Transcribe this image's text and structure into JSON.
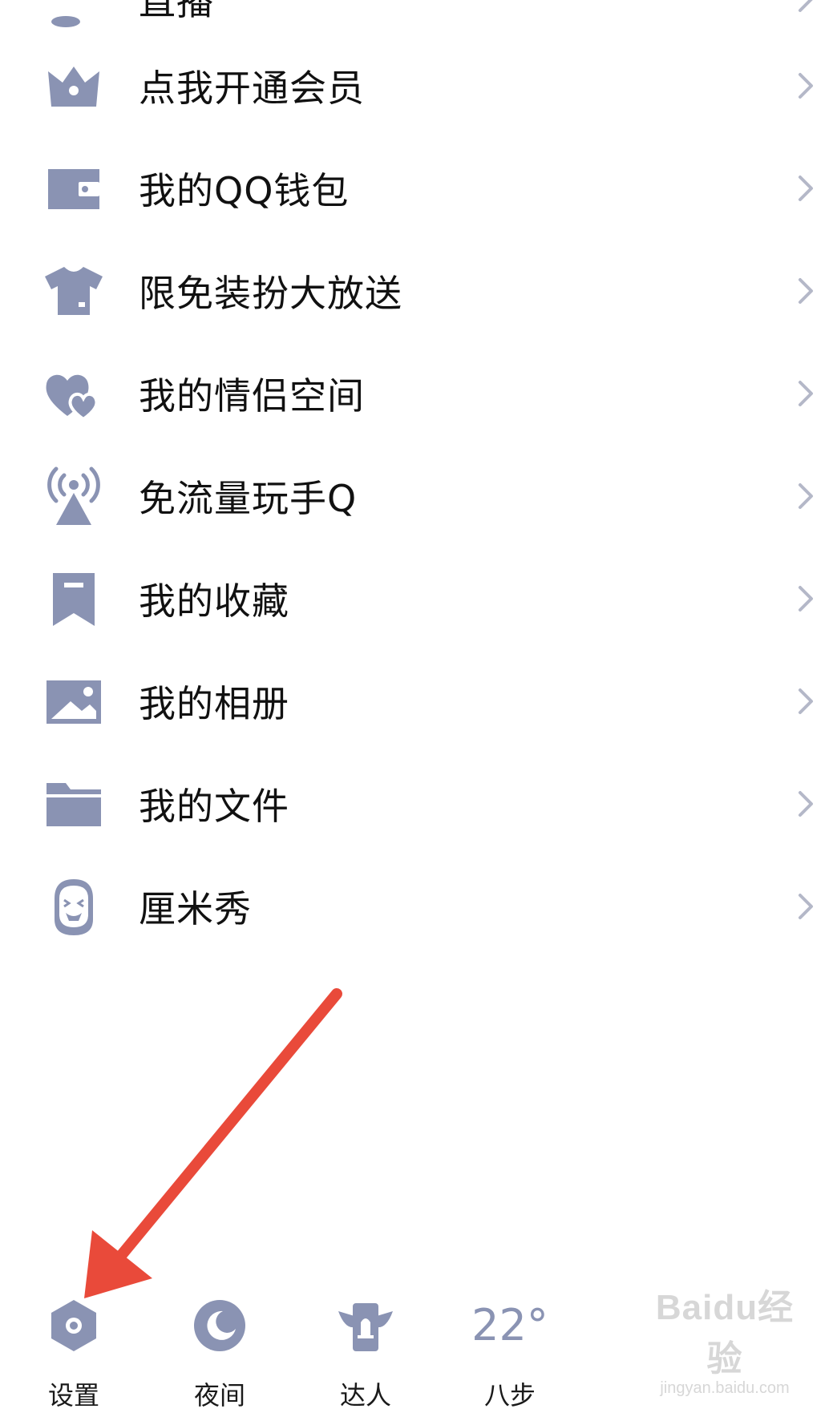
{
  "menu": {
    "items": [
      {
        "label": "直播",
        "icon": "live-icon"
      },
      {
        "label": "点我开通会员",
        "icon": "crown-icon"
      },
      {
        "label": "我的QQ钱包",
        "icon": "wallet-icon"
      },
      {
        "label": "限免装扮大放送",
        "icon": "tshirt-icon"
      },
      {
        "label": "我的情侣空间",
        "icon": "hearts-icon"
      },
      {
        "label": "免流量玩手Q",
        "icon": "signal-tower-icon"
      },
      {
        "label": "我的收藏",
        "icon": "bookmark-icon"
      },
      {
        "label": "我的相册",
        "icon": "photo-icon"
      },
      {
        "label": "我的文件",
        "icon": "folder-icon"
      },
      {
        "label": "厘米秀",
        "icon": "cmshow-icon"
      }
    ]
  },
  "bottom_bar": {
    "settings_label": "设置",
    "night_label": "夜间",
    "expert_label": "达人",
    "temperature": "22",
    "degree": "°",
    "steps_label": "八步"
  },
  "watermark": {
    "main": "Baidu经验",
    "sub": "jingyan.baidu.com"
  },
  "colors": {
    "icon": "#8a93b3",
    "text": "#111111",
    "chevron": "#b4b8c8",
    "annotation_arrow": "#e94a3a"
  }
}
